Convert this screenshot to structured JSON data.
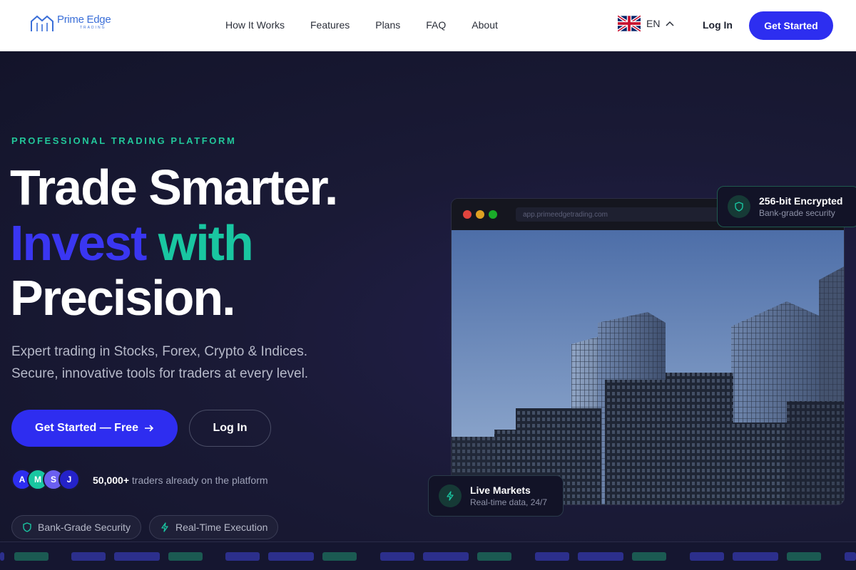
{
  "brand": {
    "name": "Prime Edge",
    "sub": "TRADING",
    "color": "#3b6fd8"
  },
  "nav": {
    "links": [
      "How It Works",
      "Features",
      "Plans",
      "FAQ",
      "About"
    ],
    "language": "EN",
    "login": "Log In",
    "cta": "Get Started"
  },
  "hero": {
    "eyebrow": "PROFESSIONAL TRADING PLATFORM",
    "headline_1": "Trade Smarter.",
    "headline_2a": "Invest",
    "headline_2b": "with",
    "headline_3": "Precision.",
    "sub_1": "Expert trading in Stocks, Forex, Crypto & Indices.",
    "sub_2": "Secure, innovative tools for traders at every level.",
    "primary_cta": "Get Started — Free",
    "secondary_cta": "Log In",
    "avatars": [
      "A",
      "M",
      "S",
      "J"
    ],
    "social_count": "50,000+",
    "social_text": " traders already on the platform",
    "pills": [
      "Bank-Grade Security",
      "Real-Time Execution"
    ]
  },
  "browser": {
    "url": "app.primeedgetrading.com"
  },
  "badges": {
    "top": {
      "title": "256-bit Encrypted",
      "sub": "Bank-grade security"
    },
    "bottom": {
      "title": "Live Markets",
      "sub": "Real-time data, 24/7"
    }
  },
  "colors": {
    "accent": "#2d2ef0",
    "green": "#19c6a1",
    "bg": "#14152a"
  }
}
